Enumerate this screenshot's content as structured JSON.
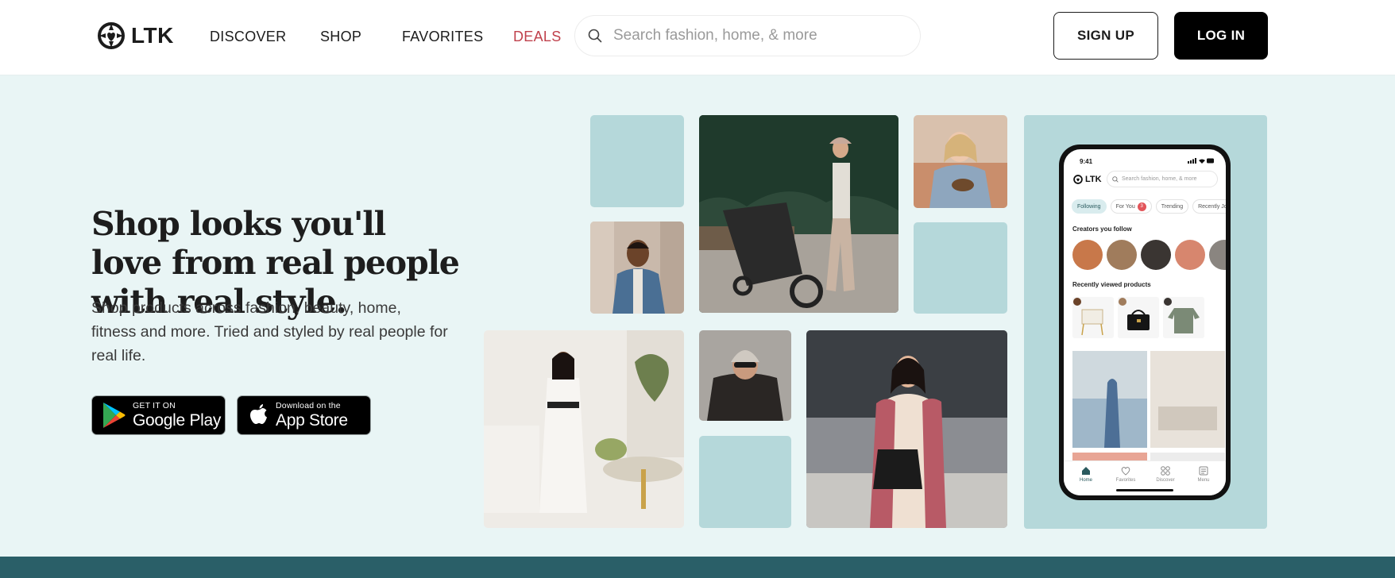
{
  "header": {
    "logo_text": "LTK",
    "nav": [
      "DISCOVER",
      "SHOP",
      "FAVORITES",
      "DEALS"
    ],
    "search": {
      "placeholder": "Search fashion, home, & more",
      "value": ""
    },
    "signup_label": "SIGN UP",
    "login_label": "LOG IN",
    "accent_color": "#c0414c"
  },
  "hero": {
    "headline": "Shop looks you'll love from real people with real style.",
    "subtext": "Shop products across fashion, beauty, home, fitness and more. Tried and styled by real people for real life.",
    "google_play": {
      "small": "GET IT ON",
      "big": "Google Play"
    },
    "app_store": {
      "small": "Download on the",
      "big": "App Store"
    }
  },
  "phone": {
    "time": "9:41",
    "logo": "LTK",
    "search_placeholder": "Search fashion, home, & more",
    "tabs": [
      "Following",
      "For You",
      "Trending",
      "Recently Joi"
    ],
    "for_you_badge": "3",
    "creators_heading": "Creators you follow",
    "recent_heading": "Recently viewed products",
    "bottom_nav": [
      "Home",
      "Favorites",
      "Discover",
      "Menu"
    ]
  },
  "colors": {
    "page_bg": "#e9f5f5",
    "tile_bg": "#b5d8da",
    "footer_band": "#2a5f68"
  }
}
